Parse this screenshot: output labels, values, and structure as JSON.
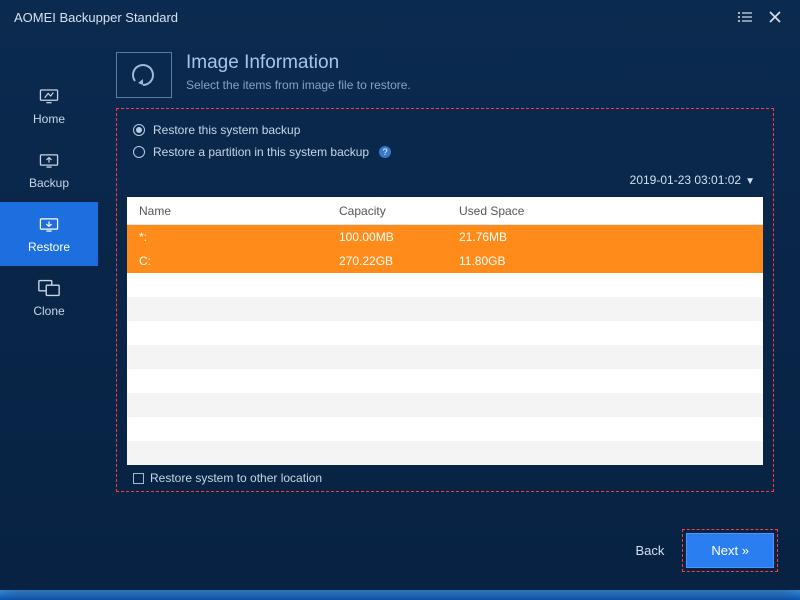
{
  "app": {
    "title": "AOMEI Backupper Standard"
  },
  "sidebar": {
    "items": [
      {
        "label": "Home"
      },
      {
        "label": "Backup"
      },
      {
        "label": "Restore"
      },
      {
        "label": "Clone"
      }
    ]
  },
  "header": {
    "title": "Image Information",
    "subtitle": "Select the items from image file to restore."
  },
  "options": {
    "opt1": "Restore this system backup",
    "opt2": "Restore a partition in this system backup"
  },
  "timestamp": "2019-01-23 03:01:02",
  "table": {
    "cols": {
      "name": "Name",
      "capacity": "Capacity",
      "used": "Used Space"
    },
    "rows": [
      {
        "name": "*:",
        "capacity": "100.00MB",
        "used": "21.76MB"
      },
      {
        "name": "C:",
        "capacity": "270.22GB",
        "used": "11.80GB"
      }
    ]
  },
  "other_location": "Restore system to other location",
  "buttons": {
    "back": "Back",
    "next": "Next »"
  }
}
